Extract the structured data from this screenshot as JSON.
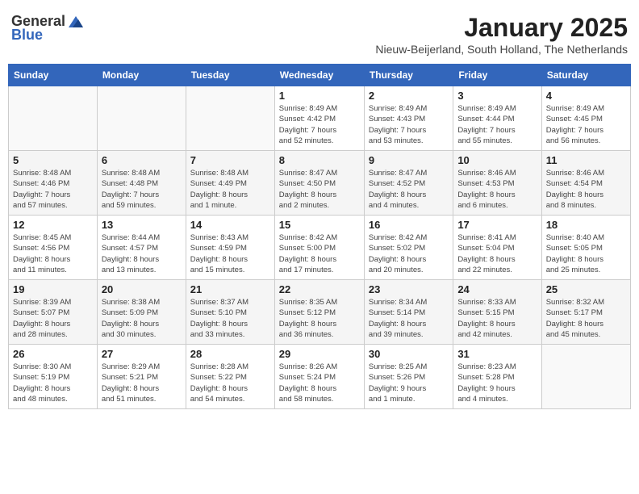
{
  "header": {
    "logo_general": "General",
    "logo_blue": "Blue",
    "month_year": "January 2025",
    "location": "Nieuw-Beijerland, South Holland, The Netherlands"
  },
  "days_of_week": [
    "Sunday",
    "Monday",
    "Tuesday",
    "Wednesday",
    "Thursday",
    "Friday",
    "Saturday"
  ],
  "weeks": [
    [
      {
        "day": "",
        "info": ""
      },
      {
        "day": "",
        "info": ""
      },
      {
        "day": "",
        "info": ""
      },
      {
        "day": "1",
        "info": "Sunrise: 8:49 AM\nSunset: 4:42 PM\nDaylight: 7 hours\nand 52 minutes."
      },
      {
        "day": "2",
        "info": "Sunrise: 8:49 AM\nSunset: 4:43 PM\nDaylight: 7 hours\nand 53 minutes."
      },
      {
        "day": "3",
        "info": "Sunrise: 8:49 AM\nSunset: 4:44 PM\nDaylight: 7 hours\nand 55 minutes."
      },
      {
        "day": "4",
        "info": "Sunrise: 8:49 AM\nSunset: 4:45 PM\nDaylight: 7 hours\nand 56 minutes."
      }
    ],
    [
      {
        "day": "5",
        "info": "Sunrise: 8:48 AM\nSunset: 4:46 PM\nDaylight: 7 hours\nand 57 minutes."
      },
      {
        "day": "6",
        "info": "Sunrise: 8:48 AM\nSunset: 4:48 PM\nDaylight: 7 hours\nand 59 minutes."
      },
      {
        "day": "7",
        "info": "Sunrise: 8:48 AM\nSunset: 4:49 PM\nDaylight: 8 hours\nand 1 minute."
      },
      {
        "day": "8",
        "info": "Sunrise: 8:47 AM\nSunset: 4:50 PM\nDaylight: 8 hours\nand 2 minutes."
      },
      {
        "day": "9",
        "info": "Sunrise: 8:47 AM\nSunset: 4:52 PM\nDaylight: 8 hours\nand 4 minutes."
      },
      {
        "day": "10",
        "info": "Sunrise: 8:46 AM\nSunset: 4:53 PM\nDaylight: 8 hours\nand 6 minutes."
      },
      {
        "day": "11",
        "info": "Sunrise: 8:46 AM\nSunset: 4:54 PM\nDaylight: 8 hours\nand 8 minutes."
      }
    ],
    [
      {
        "day": "12",
        "info": "Sunrise: 8:45 AM\nSunset: 4:56 PM\nDaylight: 8 hours\nand 11 minutes."
      },
      {
        "day": "13",
        "info": "Sunrise: 8:44 AM\nSunset: 4:57 PM\nDaylight: 8 hours\nand 13 minutes."
      },
      {
        "day": "14",
        "info": "Sunrise: 8:43 AM\nSunset: 4:59 PM\nDaylight: 8 hours\nand 15 minutes."
      },
      {
        "day": "15",
        "info": "Sunrise: 8:42 AM\nSunset: 5:00 PM\nDaylight: 8 hours\nand 17 minutes."
      },
      {
        "day": "16",
        "info": "Sunrise: 8:42 AM\nSunset: 5:02 PM\nDaylight: 8 hours\nand 20 minutes."
      },
      {
        "day": "17",
        "info": "Sunrise: 8:41 AM\nSunset: 5:04 PM\nDaylight: 8 hours\nand 22 minutes."
      },
      {
        "day": "18",
        "info": "Sunrise: 8:40 AM\nSunset: 5:05 PM\nDaylight: 8 hours\nand 25 minutes."
      }
    ],
    [
      {
        "day": "19",
        "info": "Sunrise: 8:39 AM\nSunset: 5:07 PM\nDaylight: 8 hours\nand 28 minutes."
      },
      {
        "day": "20",
        "info": "Sunrise: 8:38 AM\nSunset: 5:09 PM\nDaylight: 8 hours\nand 30 minutes."
      },
      {
        "day": "21",
        "info": "Sunrise: 8:37 AM\nSunset: 5:10 PM\nDaylight: 8 hours\nand 33 minutes."
      },
      {
        "day": "22",
        "info": "Sunrise: 8:35 AM\nSunset: 5:12 PM\nDaylight: 8 hours\nand 36 minutes."
      },
      {
        "day": "23",
        "info": "Sunrise: 8:34 AM\nSunset: 5:14 PM\nDaylight: 8 hours\nand 39 minutes."
      },
      {
        "day": "24",
        "info": "Sunrise: 8:33 AM\nSunset: 5:15 PM\nDaylight: 8 hours\nand 42 minutes."
      },
      {
        "day": "25",
        "info": "Sunrise: 8:32 AM\nSunset: 5:17 PM\nDaylight: 8 hours\nand 45 minutes."
      }
    ],
    [
      {
        "day": "26",
        "info": "Sunrise: 8:30 AM\nSunset: 5:19 PM\nDaylight: 8 hours\nand 48 minutes."
      },
      {
        "day": "27",
        "info": "Sunrise: 8:29 AM\nSunset: 5:21 PM\nDaylight: 8 hours\nand 51 minutes."
      },
      {
        "day": "28",
        "info": "Sunrise: 8:28 AM\nSunset: 5:22 PM\nDaylight: 8 hours\nand 54 minutes."
      },
      {
        "day": "29",
        "info": "Sunrise: 8:26 AM\nSunset: 5:24 PM\nDaylight: 8 hours\nand 58 minutes."
      },
      {
        "day": "30",
        "info": "Sunrise: 8:25 AM\nSunset: 5:26 PM\nDaylight: 9 hours\nand 1 minute."
      },
      {
        "day": "31",
        "info": "Sunrise: 8:23 AM\nSunset: 5:28 PM\nDaylight: 9 hours\nand 4 minutes."
      },
      {
        "day": "",
        "info": ""
      }
    ]
  ]
}
